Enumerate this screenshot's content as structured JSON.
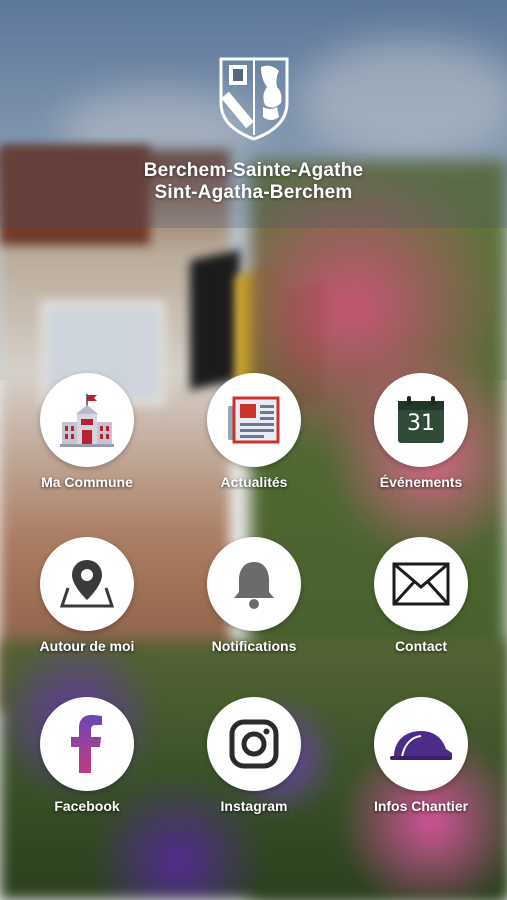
{
  "header": {
    "title_line1": "Berchem-Sainte-Agathe",
    "title_line2": "Sint-Agatha-Berchem",
    "logo_icon": "coat-of-arms-icon"
  },
  "menu": [
    {
      "id": "ma-commune",
      "label": "Ma Commune",
      "icon": "town-hall-icon"
    },
    {
      "id": "actualites",
      "label": "Actualités",
      "icon": "newspaper-icon"
    },
    {
      "id": "evenements",
      "label": "Événements",
      "icon": "calendar-icon",
      "calendar_day": "31"
    },
    {
      "id": "autour-de-moi",
      "label": "Autour de moi",
      "icon": "map-pin-icon"
    },
    {
      "id": "notifications",
      "label": "Notifications",
      "icon": "bell-icon"
    },
    {
      "id": "contact",
      "label": "Contact",
      "icon": "envelope-icon"
    },
    {
      "id": "facebook",
      "label": "Facebook",
      "icon": "facebook-icon"
    },
    {
      "id": "instagram",
      "label": "Instagram",
      "icon": "instagram-icon"
    },
    {
      "id": "infos-chantier",
      "label": "Infos Chantier",
      "icon": "hard-hat-icon"
    }
  ],
  "colors": {
    "icon_dark": "#3a3a3a",
    "town_hall_red": "#b8212f",
    "newspaper_red": "#c8352a",
    "calendar_green": "#2f4a37",
    "hard_hat_purple": "#4b2c86",
    "facebook_gradient_top": "#6a48b8",
    "facebook_gradient_bottom": "#c33a7c"
  }
}
